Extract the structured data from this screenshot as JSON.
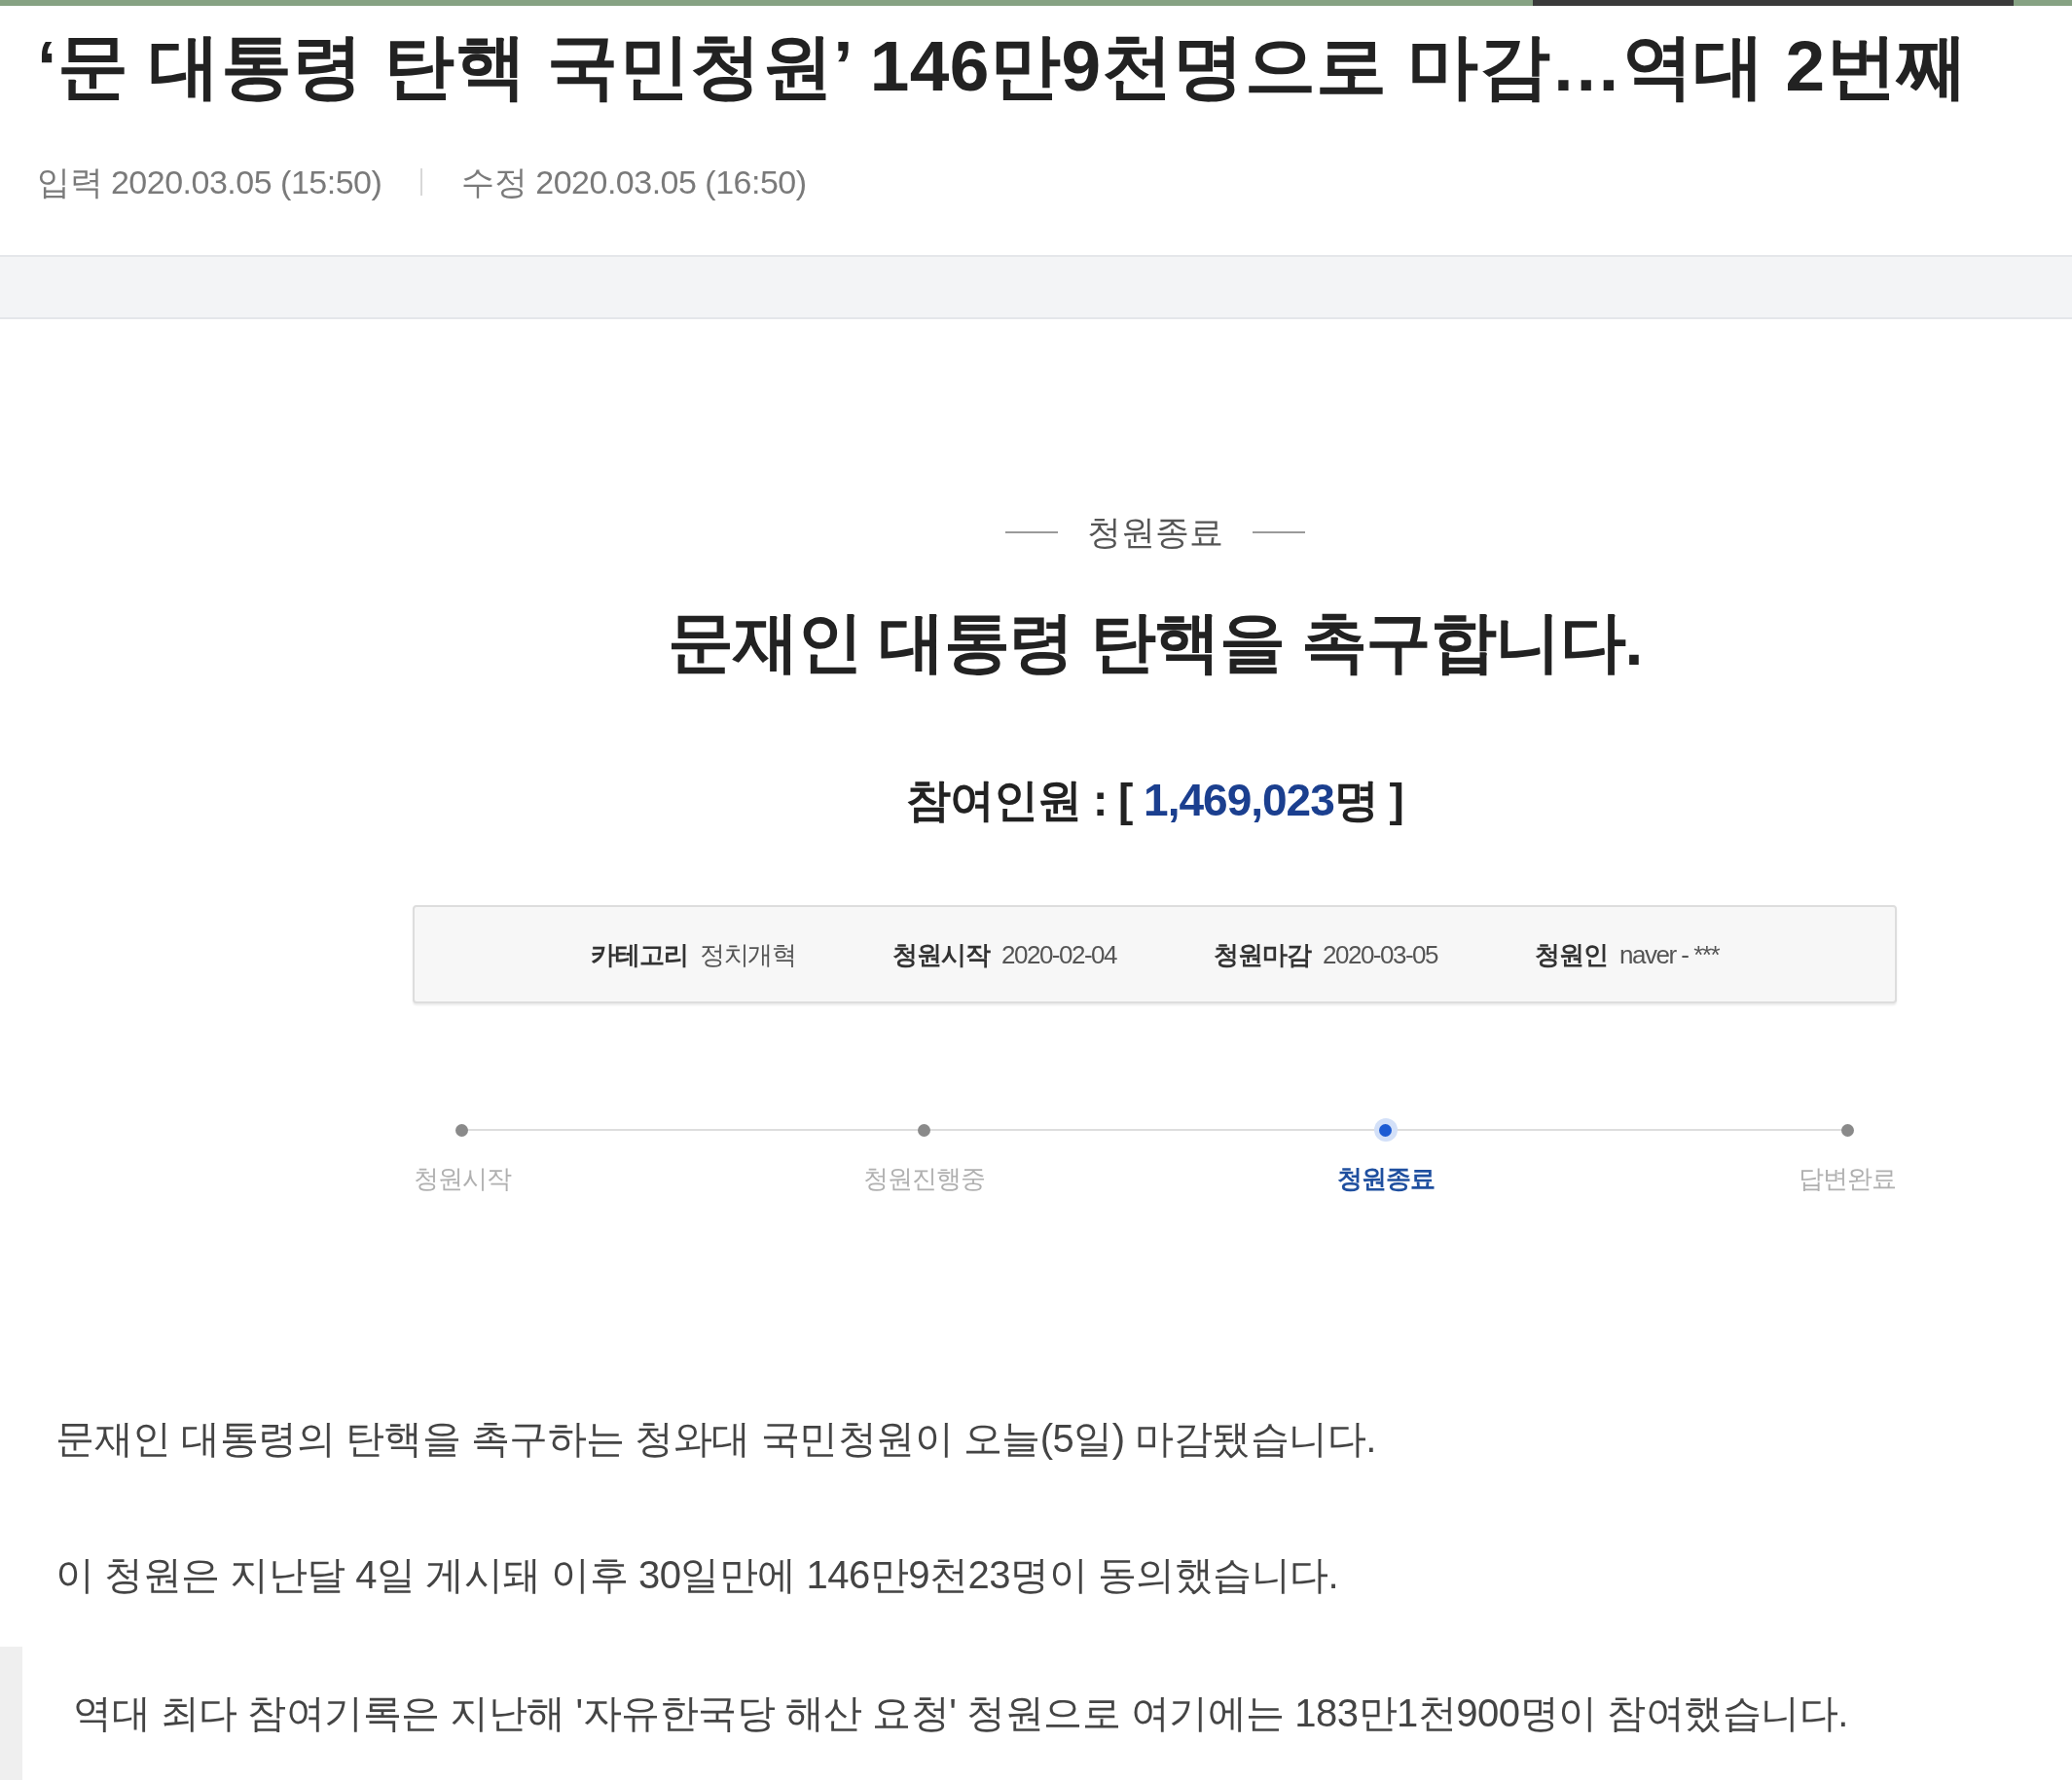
{
  "article": {
    "title": "‘문 대통령 탄핵 국민청원’ 146만9천명으로 마감…역대 2번째",
    "dates": [
      "입력 2020.03.05 (15:50)",
      "수정 2020.03.05 (16:50)"
    ]
  },
  "petition": {
    "status": "청원종료",
    "title": "문재인 대통령 탄핵을 촉구합니다.",
    "participants": {
      "prefix": "참여인원 : [",
      "count": "1,469,023",
      "suffix": "명 ]"
    },
    "details": [
      {
        "label": "카테고리",
        "value": "정치개혁"
      },
      {
        "label": "청원시작",
        "value": "2020-02-04"
      },
      {
        "label": "청원마감",
        "value": "2020-03-05"
      },
      {
        "label": "청원인",
        "value": "naver - ***"
      }
    ],
    "steps": [
      {
        "label": "청원시작",
        "selected": false
      },
      {
        "label": "청원진행중",
        "selected": false
      },
      {
        "label": "청원종료",
        "selected": true
      },
      {
        "label": "답변완료",
        "selected": false
      }
    ]
  },
  "body_paragraphs": [
    "문재인 대통령의 탄핵을 촉구하는 청와대 국민청원이 오늘(5일) 마감됐습니다.",
    "이 청원은 지난달 4일 게시돼 이후 30일만에 146만9천23명이 동의했습니다."
  ],
  "excerpt": {
    "text": "역대 최다 참여기록은 지난해 '자유한국당 해산 요청' 청원으로 여기에는 183만1천900명이 참여했습니다."
  }
}
